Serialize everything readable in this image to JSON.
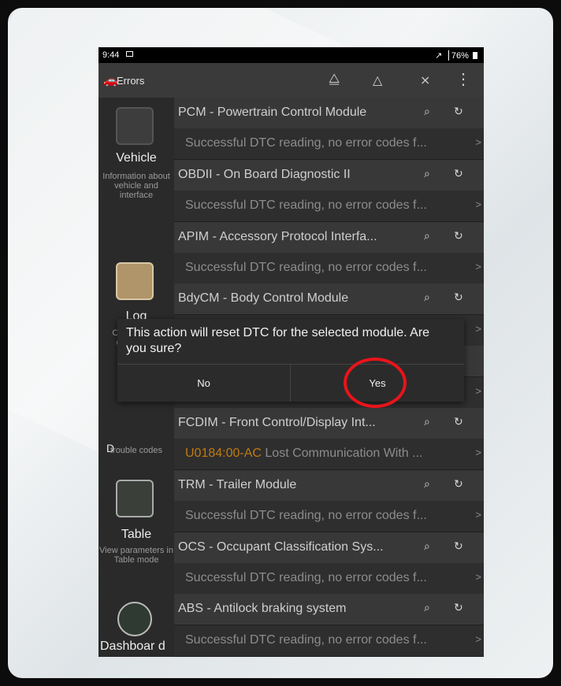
{
  "status_bar": {
    "time": "9:44",
    "battery": "76%",
    "signal": "↗▕"
  },
  "app_bar": {
    "title": "Errors",
    "logo_icon": "🚗",
    "icon_a": "⧋",
    "icon_b": "△",
    "icon_c": "⨯",
    "menu_icon": "⋮"
  },
  "sidebar": {
    "vehicle": {
      "name": "Vehicle",
      "desc": "Information about vehicle and interface"
    },
    "log": {
      "name": "Log",
      "desc": "Check log of operations"
    },
    "dtc": {
      "name": "D",
      "desc": "trouble codes"
    },
    "table": {
      "name": "Table",
      "desc": "View parameters in Table mode"
    },
    "dashboard": {
      "name": "Dashboar d"
    }
  },
  "rows": [
    {
      "type": "module",
      "text": "PCM - Powertrain Control Module"
    },
    {
      "type": "result",
      "text": "Successful DTC reading, no error codes f..."
    },
    {
      "type": "module",
      "text": "OBDII - On Board Diagnostic II"
    },
    {
      "type": "result",
      "text": "Successful DTC reading, no error codes f..."
    },
    {
      "type": "module",
      "text": "APIM - Accessory Protocol Interfa..."
    },
    {
      "type": "result",
      "text": "Successful DTC reading, no error codes f..."
    },
    {
      "type": "module",
      "text": "BdyCM - Body Control Module"
    },
    {
      "type": "result",
      "text": ""
    },
    {
      "type": "module",
      "text": ""
    },
    {
      "type": "result",
      "text": ""
    },
    {
      "type": "module",
      "text": "FCDIM - Front Control/Display Int..."
    },
    {
      "type": "error",
      "code": "U0184:00-AC",
      "text": " Lost Communication With ..."
    },
    {
      "type": "module",
      "text": "TRM - Trailer Module"
    },
    {
      "type": "result",
      "text": "Successful DTC reading, no error codes f..."
    },
    {
      "type": "module",
      "text": "OCS - Occupant Classification Sys..."
    },
    {
      "type": "result",
      "text": "Successful DTC reading, no error codes f..."
    },
    {
      "type": "module",
      "text": "ABS - Antilock braking system"
    },
    {
      "type": "result",
      "text": "Successful DTC reading, no error codes f..."
    }
  ],
  "row_icons": {
    "search": "⌕",
    "refresh": "↻",
    "chevron": ">"
  },
  "dialog": {
    "message": "This action will reset DTC for the selected module. Are you sure?",
    "no_label": "No",
    "yes_label": "Yes"
  },
  "colors": {
    "accent_ring": "#e8141b",
    "error_code": "#c07a12"
  }
}
